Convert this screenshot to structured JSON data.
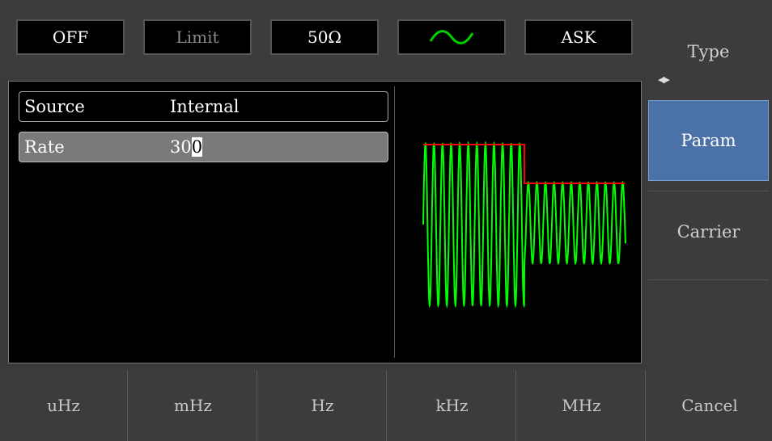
{
  "status": {
    "output": "OFF",
    "limit": "Limit",
    "impedance": "50Ω",
    "waveform_icon": "sine-wave-icon",
    "mode": "ASK"
  },
  "params": {
    "source_label": "Source",
    "source_value": "Internal",
    "rate_label": "Rate",
    "rate_value_pre": "30",
    "rate_value_cursor": "0"
  },
  "softkeys": {
    "type": "Type",
    "param": "Param",
    "carrier": "Carrier",
    "empty": ""
  },
  "units": [
    "uHz",
    "mHz",
    "Hz",
    "kHz",
    "MHz",
    "Cancel"
  ],
  "colors": {
    "wave": "#00ff00",
    "envelope": "#ff0000",
    "active_key": "#4a72a8"
  }
}
